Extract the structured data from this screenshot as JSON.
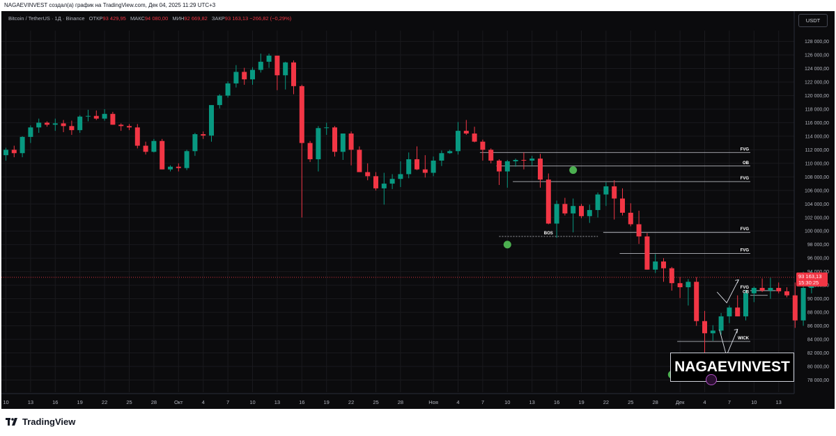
{
  "caption": "NAGAEVINVEST создал(а) график на TradingView.com, Дек 04, 2025 11:29 UTC+3",
  "symbol": {
    "name": "Bitcoin / TetherUS · 1Д · Binance",
    "open_label": "ОТКР",
    "open": "93 429,95",
    "high_label": "МАКС",
    "high": "94 080,00",
    "low_label": "МИН",
    "low": "92 669,82",
    "close_label": "ЗАКР",
    "close": "93 163,13",
    "change": "−266,82 (−0,29%)"
  },
  "currency_button": "USDT",
  "footer_brand": "TradingView",
  "watermark": "NAGAEVINVEST",
  "colors": {
    "up": "#089981",
    "down": "#f23645",
    "background": "#0b0b0d",
    "grid": "#1a1a1e",
    "marker": "#4caf50",
    "level": "#d1d4dc"
  },
  "chart_data": {
    "type": "candlestick",
    "ylim": [
      76200,
      129600
    ],
    "y_ticks": [
      78000,
      80000,
      82000,
      84000,
      86000,
      88000,
      90000,
      92000,
      94000,
      96000,
      98000,
      100000,
      102000,
      104000,
      106000,
      108000,
      110000,
      112000,
      114000,
      116000,
      118000,
      120000,
      122000,
      124000,
      126000,
      128000
    ],
    "y_tick_labels": [
      "78 000,00",
      "80 000,00",
      "82 000,00",
      "84 000,00",
      "86 000,00",
      "88 000,00",
      "90 000,00",
      "92 000,00",
      "94 000,00",
      "96 000,00",
      "98 000,00",
      "100 000,00",
      "102 000,00",
      "104 000,00",
      "106 000,00",
      "108 000,00",
      "110 000,00",
      "112 000,00",
      "114 000,00",
      "116 000,00",
      "118 000,00",
      "120 000,00",
      "122 000,00",
      "124 000,00",
      "126 000,00",
      "128 000,00"
    ],
    "x_ticks": [
      {
        "bar": 0,
        "label": "10"
      },
      {
        "bar": 3,
        "label": "13"
      },
      {
        "bar": 6,
        "label": "16"
      },
      {
        "bar": 9,
        "label": "19"
      },
      {
        "bar": 12,
        "label": "22"
      },
      {
        "bar": 15,
        "label": "25"
      },
      {
        "bar": 18,
        "label": "28"
      },
      {
        "bar": 21,
        "label": "Окт"
      },
      {
        "bar": 24,
        "label": "4"
      },
      {
        "bar": 27,
        "label": "7"
      },
      {
        "bar": 30,
        "label": "10"
      },
      {
        "bar": 33,
        "label": "13"
      },
      {
        "bar": 36,
        "label": "16"
      },
      {
        "bar": 39,
        "label": "19"
      },
      {
        "bar": 42,
        "label": "22"
      },
      {
        "bar": 45,
        "label": "25"
      },
      {
        "bar": 48,
        "label": "28"
      },
      {
        "bar": 52,
        "label": "Ноя"
      },
      {
        "bar": 55,
        "label": "4"
      },
      {
        "bar": 58,
        "label": "7"
      },
      {
        "bar": 61,
        "label": "10"
      },
      {
        "bar": 64,
        "label": "13"
      },
      {
        "bar": 67,
        "label": "16"
      },
      {
        "bar": 70,
        "label": "19"
      },
      {
        "bar": 73,
        "label": "22"
      },
      {
        "bar": 76,
        "label": "25"
      },
      {
        "bar": 79,
        "label": "28"
      },
      {
        "bar": 82,
        "label": "Дек"
      },
      {
        "bar": 85,
        "label": "4"
      },
      {
        "bar": 88,
        "label": "7"
      },
      {
        "bar": 91,
        "label": "10"
      },
      {
        "bar": 94,
        "label": "13"
      }
    ],
    "candles": [
      [
        111200,
        112300,
        110400,
        112000
      ],
      [
        112000,
        112600,
        110900,
        111500
      ],
      [
        111500,
        114000,
        110900,
        113900
      ],
      [
        113900,
        115600,
        113000,
        115300
      ],
      [
        115300,
        116600,
        114500,
        116000
      ],
      [
        116000,
        116200,
        115400,
        115700
      ],
      [
        115700,
        116600,
        114800,
        115900
      ],
      [
        115900,
        116400,
        114600,
        115500
      ],
      [
        115500,
        116300,
        114200,
        114900
      ],
      [
        114900,
        117100,
        114500,
        116900
      ],
      [
        116900,
        117900,
        116200,
        117000
      ],
      [
        117000,
        117800,
        116400,
        116600
      ],
      [
        116600,
        118000,
        116300,
        117300
      ],
      [
        117300,
        117600,
        115800,
        115700
      ],
      [
        115700,
        115900,
        114800,
        115500
      ],
      [
        115500,
        115800,
        114900,
        115300
      ],
      [
        115300,
        115800,
        112200,
        112600
      ],
      [
        112600,
        113200,
        111300,
        111700
      ],
      [
        111700,
        113600,
        111600,
        113300
      ],
      [
        113300,
        113600,
        109500,
        109100
      ],
      [
        109100,
        109700,
        108800,
        109500
      ],
      [
        109500,
        110000,
        108800,
        109300
      ],
      [
        109300,
        112000,
        109000,
        111800
      ],
      [
        111800,
        114500,
        111100,
        114300
      ],
      [
        114300,
        114700,
        113600,
        114100
      ],
      [
        114100,
        118200,
        113200,
        118600
      ],
      [
        118600,
        120200,
        118100,
        120000
      ],
      [
        120000,
        122100,
        119700,
        121800
      ],
      [
        121800,
        124500,
        121200,
        123500
      ],
      [
        123500,
        124100,
        121600,
        122400
      ],
      [
        122400,
        124200,
        121600,
        123800
      ],
      [
        123800,
        126200,
        123400,
        125000
      ],
      [
        125000,
        126200,
        124100,
        125900
      ],
      [
        125900,
        125100,
        120800,
        123000
      ],
      [
        123000,
        125000,
        120900,
        124900
      ],
      [
        124900,
        125200,
        120200,
        121400
      ],
      [
        121400,
        121600,
        102000,
        113000
      ],
      [
        113000,
        113300,
        110200,
        110600
      ],
      [
        110600,
        115500,
        108800,
        115200
      ],
      [
        115200,
        116000,
        114200,
        115300
      ],
      [
        115300,
        115500,
        111000,
        111700
      ],
      [
        111700,
        114000,
        110500,
        114400
      ],
      [
        114400,
        114700,
        109700,
        112000
      ],
      [
        112000,
        112500,
        108700,
        108700
      ],
      [
        108700,
        110000,
        107500,
        108100
      ],
      [
        108100,
        108700,
        106000,
        106300
      ],
      [
        106300,
        108600,
        103900,
        107000
      ],
      [
        107000,
        108400,
        106200,
        107700
      ],
      [
        107700,
        110300,
        106500,
        108400
      ],
      [
        108400,
        111600,
        107800,
        110600
      ],
      [
        110600,
        112500,
        109000,
        109100
      ],
      [
        109100,
        111200,
        107900,
        108600
      ],
      [
        108600,
        111000,
        108100,
        110400
      ],
      [
        110400,
        111900,
        109600,
        111500
      ],
      [
        111500,
        112000,
        111400,
        111800
      ],
      [
        111800,
        116100,
        111300,
        114800
      ],
      [
        114800,
        116400,
        114200,
        114400
      ],
      [
        114400,
        115400,
        113100,
        113200
      ],
      [
        113200,
        113500,
        110400,
        112000
      ],
      [
        112000,
        112200,
        110000,
        110400
      ],
      [
        110400,
        110600,
        106800,
        108800
      ],
      [
        108800,
        110500,
        106400,
        110300
      ],
      [
        110300,
        110700,
        109500,
        110500
      ],
      [
        110500,
        111600,
        109100,
        110400
      ],
      [
        110400,
        111100,
        109700,
        110700
      ],
      [
        110700,
        111400,
        106400,
        107600
      ],
      [
        107600,
        108500,
        101000,
        101100
      ],
      [
        101100,
        104500,
        99000,
        104000
      ],
      [
        104000,
        104900,
        102300,
        102600
      ],
      [
        102600,
        104800,
        99800,
        103700
      ],
      [
        103700,
        104000,
        101900,
        102200
      ],
      [
        102200,
        103900,
        101200,
        103100
      ],
      [
        103100,
        105700,
        102000,
        105400
      ],
      [
        105400,
        107200,
        103700,
        106600
      ],
      [
        106600,
        107500,
        101700,
        104800
      ],
      [
        104800,
        106300,
        102300,
        102700
      ],
      [
        102700,
        104100,
        100700,
        101000
      ],
      [
        101000,
        103000,
        98100,
        99200
      ],
      [
        99200,
        99700,
        94600,
        94300
      ],
      [
        94300,
        96600,
        93800,
        95500
      ],
      [
        95500,
        96000,
        92500,
        94500
      ],
      [
        94500,
        94700,
        91200,
        92300
      ],
      [
        92300,
        93200,
        90100,
        91700
      ],
      [
        91700,
        92900,
        89000,
        92500
      ],
      [
        92500,
        93200,
        86000,
        86700
      ],
      [
        86700,
        88200,
        80500,
        84900
      ],
      [
        84900,
        86100,
        83800,
        85300
      ],
      [
        85300,
        87900,
        84700,
        87400
      ],
      [
        87400,
        89000,
        86400,
        88700
      ],
      [
        88700,
        90500,
        87500,
        87400
      ],
      [
        87400,
        91300,
        86800,
        90800
      ],
      [
        90800,
        91800,
        89500,
        91600
      ],
      [
        91600,
        93000,
        91000,
        91200
      ],
      [
        91200,
        93100,
        90000,
        91600
      ],
      [
        91600,
        92400,
        90800,
        91100
      ],
      [
        91100,
        91700,
        90200,
        90500
      ],
      [
        90500,
        92400,
        85700,
        86800
      ],
      [
        86800,
        94000,
        86000,
        91600
      ],
      [
        91600,
        94100,
        90800,
        93400
      ],
      [
        93400,
        94080,
        92670,
        93163
      ]
    ],
    "levels": [
      {
        "label": "FVG",
        "price": 111600,
        "from_bar": 58
      },
      {
        "label": "OB",
        "price": 109600,
        "from_bar": 60
      },
      {
        "label": "FVG",
        "price": 107300,
        "from_bar": 62
      },
      {
        "label": "FVG",
        "price": 99800,
        "from_bar": 73
      },
      {
        "label": "FVG",
        "price": 96700,
        "from_bar": 75
      },
      {
        "label": "FVG",
        "price": 91200,
        "from_bar": 94
      },
      {
        "label": "OB",
        "price": 90500,
        "from_bar": 93
      },
      {
        "label": "WICK",
        "price": 83700,
        "from_bar": 82
      }
    ],
    "bos": {
      "label": "BOS",
      "price": 99200,
      "from_bar": 60,
      "to_bar": 72
    },
    "markers": [
      {
        "bar": 61,
        "price": 98000
      },
      {
        "bar": 69,
        "price": 109000
      },
      {
        "bar": 81,
        "price": 78800
      }
    ],
    "current_price": {
      "label": "93 163,13",
      "timer": "15:30:25",
      "price": 93163
    }
  }
}
